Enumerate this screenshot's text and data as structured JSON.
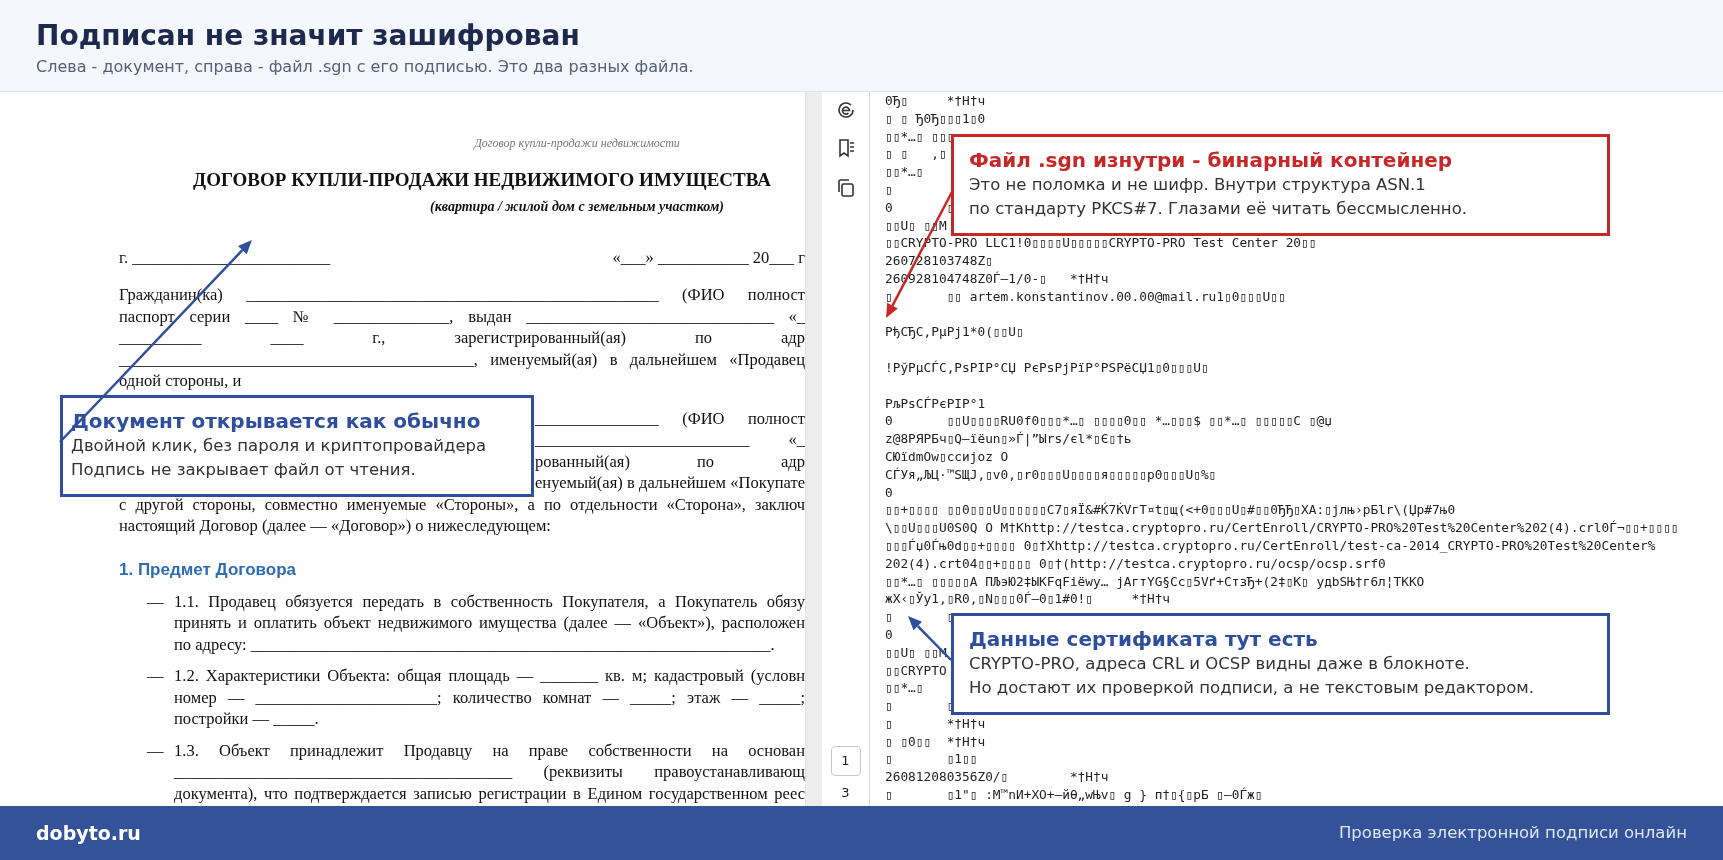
{
  "header": {
    "title": "Подписан не значит зашифрован",
    "subtitle": "Слева - документ, справа - файл .sgn с его подписью. Это два разных файла."
  },
  "document": {
    "blocks": [
      {
        "kind": "running_head",
        "text": "Договор купли-продажи недвижимости"
      },
      {
        "kind": "title",
        "text": "ДОГОВОР КУПЛИ-ПРОДАЖИ НЕДВИЖИМОГО ИМУЩЕСТВА"
      },
      {
        "kind": "subtitle",
        "text": "(квартира / жилой дом с земельным участком)"
      },
      {
        "kind": "split",
        "left": "г. ________________________",
        "right": "«___» ___________ 20___ г"
      },
      {
        "kind": "paragraph",
        "lines": [
          {
            "kind": "justify",
            "text": "Гражданин(ка) __________________________________________________ (ФИО полност"
          },
          {
            "kind": "justify",
            "text": "паспорт серии ____ № ______________, выдан ______________________________ «_"
          },
          {
            "kind": "justify",
            "text": "__________ ____ г., зарегистрированный(ая) по адр"
          },
          {
            "kind": "justify",
            "text": "___________________________________________, именуемый(ая) в дальнейшем «Продавец"
          },
          {
            "kind": "left",
            "text": "одной стороны, и"
          }
        ]
      },
      {
        "kind": "paragraph",
        "lines": [
          {
            "kind": "covered",
            "text": "_______________ (ФИО полност"
          },
          {
            "kind": "covered",
            "text": "__________________________ «_"
          },
          {
            "kind": "covered",
            "text": "рованный(ая) по адр"
          },
          {
            "kind": "covered",
            "text": "енуемый(ая) в дальнейшем «Покупате"
          },
          {
            "kind": "justify",
            "text": "с другой стороны, совместно именуемые «Стороны», а по отдельности «Сторона», заключ"
          },
          {
            "kind": "left",
            "text": "настоящий Договор (далее — «Договор») о нижеследующем:"
          }
        ]
      },
      {
        "kind": "heading",
        "text": "1. Предмет Договора"
      },
      {
        "kind": "list_item",
        "marker": "—",
        "lines": [
          {
            "kind": "justify",
            "text": "1.1. Продавец обязуется передать в собственность Покупателя, а Покупатель обязу"
          },
          {
            "kind": "justify",
            "text": "принять и оплатить объект недвижимого имущества (далее — «Объект»), расположен"
          },
          {
            "kind": "left",
            "text": "по адресу: _______________________________________________________________."
          }
        ]
      },
      {
        "kind": "list_item",
        "marker": "—",
        "lines": [
          {
            "kind": "justify",
            "text": "1.2. Характеристики Объекта: общая площадь — _______ кв. м; кадастровый (условн"
          },
          {
            "kind": "justify",
            "text": "номер — ______________________; количество комнат — _____; этаж — _____;"
          },
          {
            "kind": "left",
            "text": "постройки — _____."
          }
        ]
      },
      {
        "kind": "list_item",
        "marker": "—",
        "lines": [
          {
            "kind": "justify",
            "text": "1.3. Объект принадлежит Продавцу на праве собственности на основан"
          },
          {
            "kind": "justify",
            "text": "_________________________________________ (реквизиты правоустанавливающ"
          },
          {
            "kind": "justify",
            "text": "документа), что подтверждается записью регистрации в Едином государственном реес"
          }
        ]
      }
    ]
  },
  "viewer": {
    "page_field": "1",
    "page_count": "3"
  },
  "binary_lines": [
    {
      "kind": "text",
      "text": "0Ђ▯     *†H†ч"
    },
    {
      "kind": "text",
      "text": "▯ ▯ Ђ0Ђ▯▯▯1▯0"
    },
    {
      "kind": "text",
      "text": "▯▯*…▯ ▯▯▯"
    },
    {
      "kind": "text",
      "text": "▯ ▯   ,▯"
    },
    {
      "kind": "text",
      "text": "▯▯*…▯"
    },
    {
      "kind": "text",
      "text": "▯"
    },
    {
      "kind": "text",
      "text": "0       ▯"
    },
    {
      "kind": "text",
      "text": "▯▯U▯ ▯▯M"
    },
    {
      "kind": "text",
      "text": "▯▯CRYPTO-PRO LLC1!0▯▯▯▯U▯▯▯▯▯CRYPTO-PRO Test Center 20▯▯"
    },
    {
      "kind": "text",
      "text": "260728103748Z▯"
    },
    {
      "kind": "text",
      "text": "260928104748Z0Ѓ–1/0-▯   *†H†ч"
    },
    {
      "kind": "text",
      "text": "▯       ▯▯ artem.konstantinov.00.00@mail.ru1▯0▯▯▯U▯▯"
    },
    {
      "kind": "blank"
    },
    {
      "kind": "text",
      "text": "PђCЂC‚PµPj1*0(▯▯U▯"
    },
    {
      "kind": "blank"
    },
    {
      "kind": "text",
      "text": "!PўPµCЃC‚PsPIP°CЏ PєPsPjPïP°PSPëCЏ1▯0▯▯▯U▯"
    },
    {
      "kind": "blank"
    },
    {
      "kind": "text",
      "text": "PљPsCЃPєPIP°1"
    },
    {
      "kind": "text",
      "text": "0       ▯▯U▯▯▯▯RU0f0▯▯▯*…▯ ▯▯▯▯0▯▯ *…▯▯▯$ ▯▯*…▯ ▯▯▯▯▯C ▯@џ"
    },
    {
      "kind": "text",
      "text": "z@8PЯPБч▯Q–ïëun▯»Ѓ|”Ыrs/єl*▯Є▯†ь"
    },
    {
      "kind": "text",
      "text": "CЮïdmOw▯ссиjoz O"
    },
    {
      "kind": "text",
      "text": "CЃУя„ЉЦ·™SЩЈ‚▯v0‚▯r0▯▯▯U▯▯▯▯я▯▯▯▯▯p0▯▯▯U▯%▯"
    },
    {
      "kind": "text",
      "text": "0"
    },
    {
      "kind": "text",
      "text": "▯▯+▯▯▯▯ ▯▯0▯▯▯U▯▯▯▯▯▯C7▯яЇ&#Ќ7ЌVгТ¤t▯щ(<+0▯▯▯U▯#▯▯0ЂЂ▯ХА:▯jлњ›рБlr\\(Џp#7њ0"
    },
    {
      "kind": "text",
      "text": "\\▯▯U▯▯▯U0S0Q O M†Khttp://testca.cryptopro.ru/CertEnroll/CRYPTO-PRO%20Test%20Center%202(4).crl0Ѓ¬▯▯+▯▯▯▯"
    },
    {
      "kind": "text",
      "text": "▯▯▯Ѓџ0Ѓњ0d▯▯+▯▯▯▯ 0▯†Xhttp://testca.cryptopro.ru/CertEnroll/test-ca-2014_CRYPTO-PRO%20Test%20Center%"
    },
    {
      "kind": "text",
      "text": "202(4).crt04▯▯+▯▯▯▯ 0▯†(http://testca.cryptopro.ru/ocsp/ocsp.srf0"
    },
    {
      "kind": "text",
      "text": "▯▯*…▯ ▯▯▯▯▯А ПЉэЮ2‡ЫKFqFiёwy… jАгтYG§Сс▯5Vґ+CтзЂ+(2‡▯K▯ удbSЊ†г6л¦TKKO"
    },
    {
      "kind": "text",
      "text": "жХ‹▯Ўy1,▯R0,▯N▯▯▯0Ѓ–0▯1#0!▯     *†H†ч"
    },
    {
      "kind": "text",
      "text": "▯       ▯"
    },
    {
      "kind": "text",
      "text": "0"
    },
    {
      "kind": "text",
      "text": "▯▯U▯ ▯▯M"
    },
    {
      "kind": "text",
      "text": "▯▯CRYPTO"
    },
    {
      "kind": "text",
      "text": "▯▯*…▯"
    },
    {
      "kind": "text",
      "text": "▯       ▯"
    },
    {
      "kind": "text",
      "text": "▯       *†H†ч"
    },
    {
      "kind": "text",
      "text": "▯ ▯0▯▯  *†H†ч"
    },
    {
      "kind": "text",
      "text": "▯       ▯1▯▯"
    },
    {
      "kind": "text",
      "text": "260812080356Z0/▯        *†H†ч"
    },
    {
      "kind": "text",
      "text": "▯       ▯1\"▯ :M™nИ+XО+—йѲ„wЊv▯ g } п†▯{▯рБ ▯–0Ѓж▯"
    }
  ],
  "callouts": [
    {
      "color": "#c62828",
      "title": "Файл .sgn изнутри - бинарный контейнер",
      "body": [
        "Это не поломка и не шифр. Внутри структура ASN.1",
        "по стандарту PKCS#7. Глазами её читать бессмысленно."
      ]
    },
    {
      "color": "#2f4f9e",
      "title": "Документ открывается как обычно",
      "body": [
        "Двойной клик, без пароля и криптопровайдера",
        "Подпись не закрывает файл от чтения."
      ]
    },
    {
      "color": "#2f4f9e",
      "title": "Данные сертификата тут есть",
      "body": [
        "CRYPTO-PRO, адреса CRL и OCSP видны даже в блокноте.",
        "Но достают их проверкой подписи, а не текстовым редактором."
      ]
    }
  ],
  "footer": {
    "site": "dobyto.ru",
    "tagline": "Проверка электронной подписи онлайн"
  }
}
